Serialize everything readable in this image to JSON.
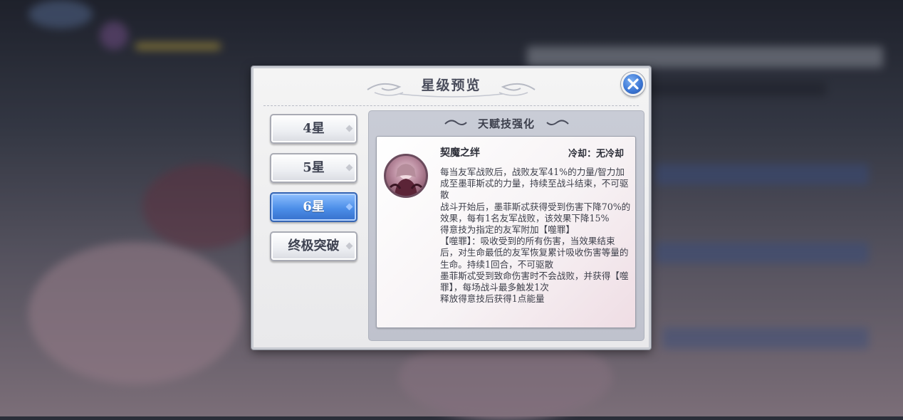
{
  "dialog": {
    "title": "星级预览"
  },
  "tabs": [
    {
      "label": "4星",
      "active": false
    },
    {
      "label": "5星",
      "active": false
    },
    {
      "label": "6星",
      "active": true
    },
    {
      "label": "终极突破",
      "active": false
    }
  ],
  "talent": {
    "heading": "天赋技强化",
    "skill_name": "契魔之绊",
    "cooldown": "冷却：无冷却",
    "description": [
      "每当友军战败后，战败友军41%的力量/智力加成至墨菲斯忒的力量，持续至战斗结束，不可驱散",
      "战斗开始后，墨菲斯忒获得受到伤害下降70%的效果，每有1名友军战败，该效果下降15%",
      "得意技为指定的友军附加【噬罪】",
      "【噬罪】：吸收受到的所有伤害，当效果结束后，对生命最低的友军恢复累计吸收伤害等量的生命。持续1回合，不可驱散",
      "墨菲斯忒受到致命伤害时不会战败，并获得【噬罪】，每场战斗最多触发1次",
      "释放得意技后获得1点能量"
    ]
  },
  "icons": {
    "close": "close-icon",
    "portrait": "character-portrait"
  },
  "colors": {
    "accent_blue": "#4c8ee8",
    "title_text": "#4a4d5c"
  }
}
